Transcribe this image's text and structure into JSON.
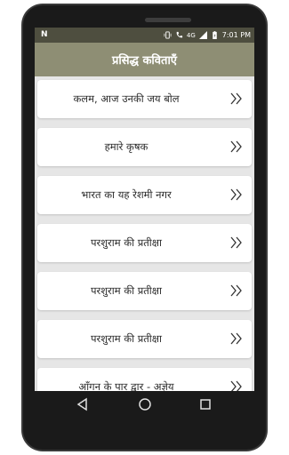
{
  "status_bar": {
    "logo": "N",
    "network": "4G",
    "time": "7:01 PM"
  },
  "app_bar": {
    "title": "प्रसिद्ध कविताएँ"
  },
  "poems": [
    {
      "label": "कलम, आज उनकी जय बोल"
    },
    {
      "label": "हमारे कृषक"
    },
    {
      "label": "भारत का यह रेशमी नगर"
    },
    {
      "label": "परशुराम की प्रतीक्षा"
    },
    {
      "label": "परशुराम की प्रतीक्षा"
    },
    {
      "label": "परशुराम की प्रतीक्षा"
    },
    {
      "label": "आँगन के पार द्वार - अज्ञेय"
    }
  ],
  "icons": {
    "chevron": "double-chevron-right-icon",
    "back": "back-triangle-icon",
    "home": "home-circle-icon",
    "recents": "recents-square-icon"
  },
  "colors": {
    "status_bar": "#4e4e3f",
    "app_bar": "#8e8e74",
    "background": "#e6e6e6",
    "card": "#ffffff"
  }
}
